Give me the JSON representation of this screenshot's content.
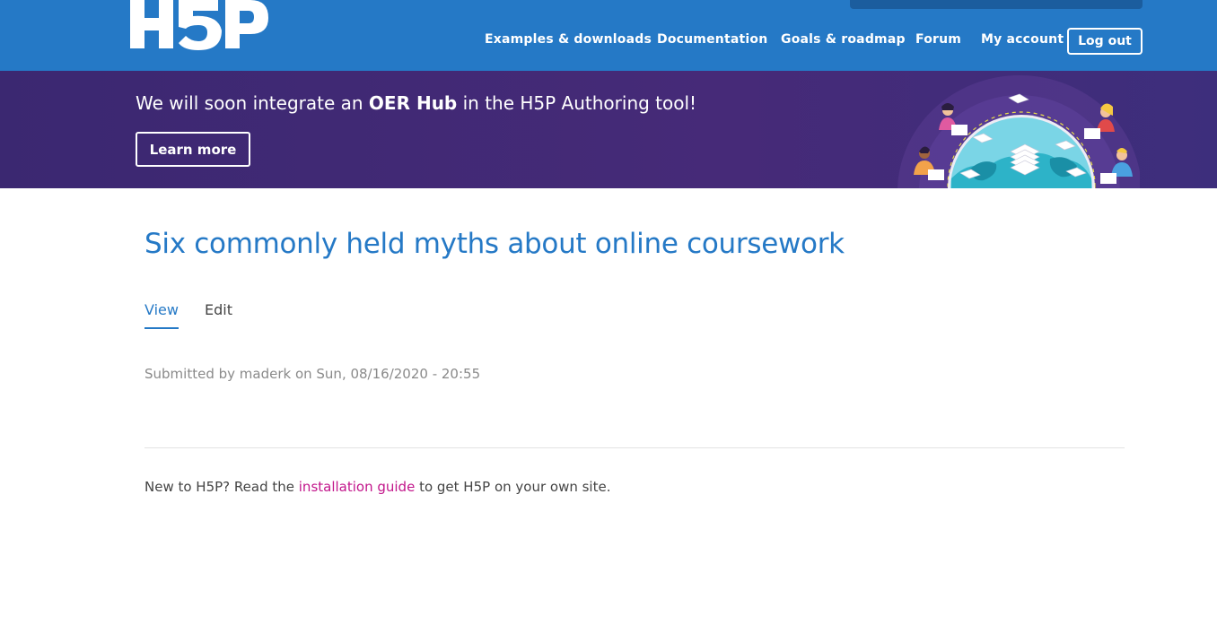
{
  "header": {
    "logo_text": "H5P",
    "nav": [
      {
        "label": "Examples & downloads"
      },
      {
        "label": "Documentation"
      },
      {
        "label": "Goals & roadmap"
      },
      {
        "label": "Forum"
      },
      {
        "label": "My account"
      }
    ],
    "logout_label": "Log out"
  },
  "banner": {
    "text_before": "We will soon integrate an ",
    "text_bold": "OER Hub",
    "text_after": " in the H5P Authoring tool!",
    "button_label": "Learn more"
  },
  "content": {
    "title": "Six commonly held myths about online coursework",
    "tabs": [
      {
        "label": "View",
        "active": true
      },
      {
        "label": "Edit",
        "active": false
      }
    ],
    "submitted": "Submitted by maderk on Sun, 08/16/2020 - 20:55",
    "footer_prefix": "New to H5P? Read the ",
    "footer_link": "installation guide",
    "footer_suffix": " to get H5P on your own site."
  },
  "colors": {
    "header_bg": "#2579c6",
    "banner_bg": "#452a78",
    "title": "#2579c6",
    "link": "#c2168b"
  }
}
